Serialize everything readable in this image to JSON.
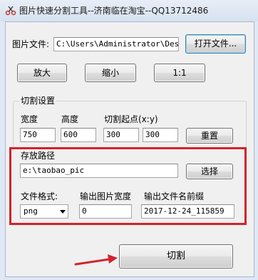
{
  "window": {
    "title": "图片快速分割工具--济南临在淘宝--QQ13712486",
    "icon": "scissors-icon"
  },
  "file": {
    "label": "图片文件:",
    "path_value": "C:\\Users\\Administrator\\Deskt",
    "open_button": "打开文件..."
  },
  "zoom": {
    "zoom_in": "放大",
    "zoom_out": "缩小",
    "actual": "1:1"
  },
  "split_settings": {
    "group_title": "切割设置",
    "width_label": "宽度",
    "height_label": "高度",
    "start_label": "切割起点(x:y)",
    "width_value": "750",
    "height_value": "600",
    "start_x_value": "300",
    "start_y_value": "300",
    "reset_button": "重置"
  },
  "save": {
    "path_label": "存放路径",
    "path_value": "e:\\taobao_pic",
    "choose_button": "选择",
    "format_label": "文件格式:",
    "format_selected": "png",
    "out_width_label": "输出图片宽度",
    "out_width_value": "0",
    "prefix_label": "输出文件名前缀",
    "prefix_value": "2017-12-24_115859"
  },
  "action": {
    "split_button": "切割"
  },
  "annotation": {
    "highlight_color": "#d4232a"
  }
}
